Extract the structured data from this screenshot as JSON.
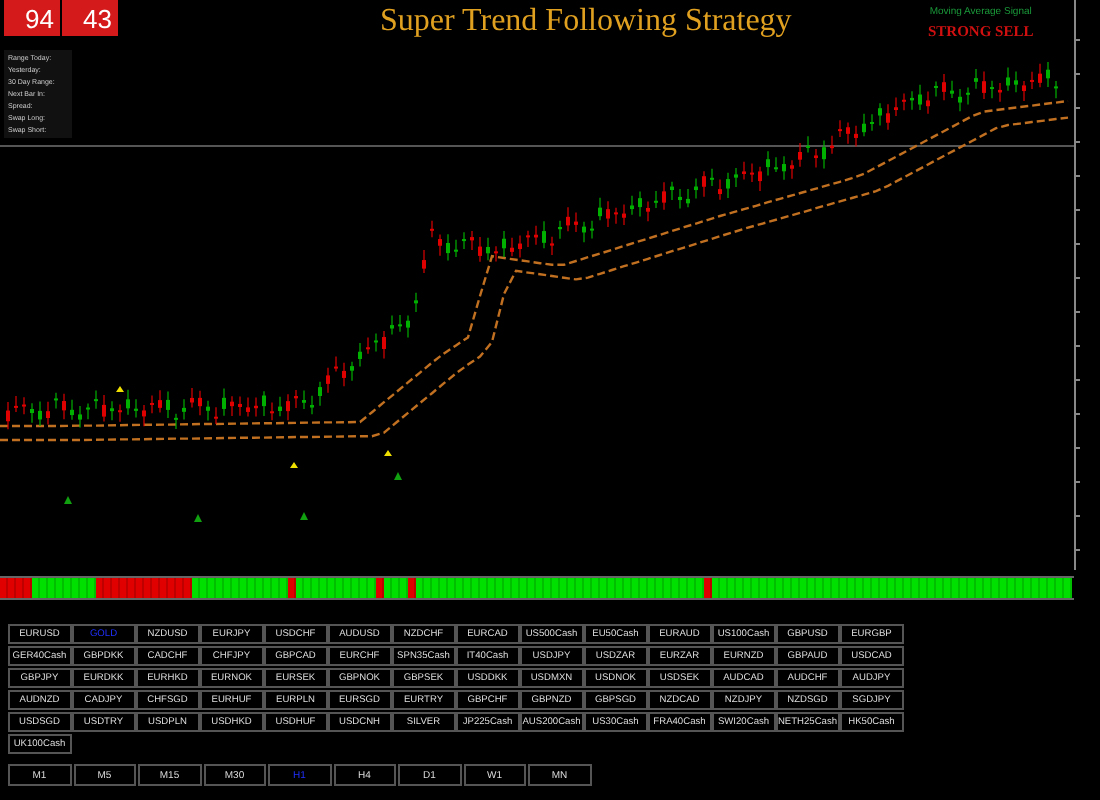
{
  "title": "Super Trend Following Strategy",
  "counters": [
    {
      "value": "94"
    },
    {
      "value": "43"
    }
  ],
  "info_panel": {
    "rows": [
      {
        "label": "Range Today:"
      },
      {
        "label": "Yesterday:"
      },
      {
        "label": "30 Day Range:"
      },
      {
        "label": "Next Bar In:"
      },
      {
        "label": "Spread:"
      },
      {
        "label": "Swap Long:"
      },
      {
        "label": "Swap Short:"
      }
    ]
  },
  "signal": {
    "caption": "Moving Average Signal",
    "verdict": "STRONG SELL"
  },
  "trend_bar": {
    "bars": [
      {
        "kind": "sell"
      },
      {
        "kind": "sell"
      },
      {
        "kind": "sell"
      },
      {
        "kind": "sell"
      },
      {
        "kind": "buy"
      },
      {
        "kind": "buy"
      },
      {
        "kind": "buy"
      },
      {
        "kind": "buy"
      },
      {
        "kind": "buy"
      },
      {
        "kind": "buy"
      },
      {
        "kind": "buy"
      },
      {
        "kind": "buy"
      },
      {
        "kind": "sell"
      },
      {
        "kind": "sell"
      },
      {
        "kind": "sell"
      },
      {
        "kind": "sell"
      },
      {
        "kind": "sell"
      },
      {
        "kind": "sell"
      },
      {
        "kind": "sell"
      },
      {
        "kind": "sell"
      },
      {
        "kind": "sell"
      },
      {
        "kind": "sell"
      },
      {
        "kind": "sell"
      },
      {
        "kind": "sell"
      },
      {
        "kind": "buy"
      },
      {
        "kind": "buy"
      },
      {
        "kind": "buy"
      },
      {
        "kind": "buy"
      },
      {
        "kind": "buy"
      },
      {
        "kind": "buy"
      },
      {
        "kind": "buy"
      },
      {
        "kind": "buy"
      },
      {
        "kind": "buy"
      },
      {
        "kind": "buy"
      },
      {
        "kind": "buy"
      },
      {
        "kind": "buy"
      },
      {
        "kind": "sell"
      },
      {
        "kind": "buy"
      },
      {
        "kind": "buy"
      },
      {
        "kind": "buy"
      },
      {
        "kind": "buy"
      },
      {
        "kind": "buy"
      },
      {
        "kind": "buy"
      },
      {
        "kind": "buy"
      },
      {
        "kind": "buy"
      },
      {
        "kind": "buy"
      },
      {
        "kind": "buy"
      },
      {
        "kind": "sell"
      },
      {
        "kind": "buy"
      },
      {
        "kind": "buy"
      },
      {
        "kind": "buy"
      },
      {
        "kind": "sell"
      },
      {
        "kind": "buy"
      },
      {
        "kind": "buy"
      },
      {
        "kind": "buy"
      },
      {
        "kind": "buy"
      },
      {
        "kind": "buy"
      },
      {
        "kind": "buy"
      },
      {
        "kind": "buy"
      },
      {
        "kind": "buy"
      },
      {
        "kind": "buy"
      },
      {
        "kind": "buy"
      },
      {
        "kind": "buy"
      },
      {
        "kind": "buy"
      },
      {
        "kind": "buy"
      },
      {
        "kind": "buy"
      },
      {
        "kind": "buy"
      },
      {
        "kind": "buy"
      },
      {
        "kind": "buy"
      },
      {
        "kind": "buy"
      },
      {
        "kind": "buy"
      },
      {
        "kind": "buy"
      },
      {
        "kind": "buy"
      },
      {
        "kind": "buy"
      },
      {
        "kind": "buy"
      },
      {
        "kind": "buy"
      },
      {
        "kind": "buy"
      },
      {
        "kind": "buy"
      },
      {
        "kind": "buy"
      },
      {
        "kind": "buy"
      },
      {
        "kind": "buy"
      },
      {
        "kind": "buy"
      },
      {
        "kind": "buy"
      },
      {
        "kind": "buy"
      },
      {
        "kind": "buy"
      },
      {
        "kind": "buy"
      },
      {
        "kind": "buy"
      },
      {
        "kind": "buy"
      },
      {
        "kind": "sell"
      },
      {
        "kind": "buy"
      },
      {
        "kind": "buy"
      },
      {
        "kind": "buy"
      },
      {
        "kind": "buy"
      },
      {
        "kind": "buy"
      },
      {
        "kind": "buy"
      },
      {
        "kind": "buy"
      },
      {
        "kind": "buy"
      },
      {
        "kind": "buy"
      },
      {
        "kind": "buy"
      },
      {
        "kind": "buy"
      },
      {
        "kind": "buy"
      },
      {
        "kind": "buy"
      },
      {
        "kind": "buy"
      },
      {
        "kind": "buy"
      },
      {
        "kind": "buy"
      },
      {
        "kind": "buy"
      },
      {
        "kind": "buy"
      },
      {
        "kind": "buy"
      },
      {
        "kind": "buy"
      },
      {
        "kind": "buy"
      },
      {
        "kind": "buy"
      },
      {
        "kind": "buy"
      },
      {
        "kind": "buy"
      },
      {
        "kind": "buy"
      },
      {
        "kind": "buy"
      },
      {
        "kind": "buy"
      },
      {
        "kind": "buy"
      },
      {
        "kind": "buy"
      },
      {
        "kind": "buy"
      },
      {
        "kind": "buy"
      },
      {
        "kind": "buy"
      },
      {
        "kind": "buy"
      },
      {
        "kind": "buy"
      },
      {
        "kind": "buy"
      },
      {
        "kind": "buy"
      },
      {
        "kind": "buy"
      },
      {
        "kind": "buy"
      },
      {
        "kind": "buy"
      },
      {
        "kind": "buy"
      },
      {
        "kind": "buy"
      },
      {
        "kind": "buy"
      },
      {
        "kind": "buy"
      },
      {
        "kind": "buy"
      },
      {
        "kind": "buy"
      }
    ]
  },
  "symbols": [
    {
      "label": "EURUSD",
      "selected": false
    },
    {
      "label": "GOLD",
      "selected": true
    },
    {
      "label": "NZDUSD",
      "selected": false
    },
    {
      "label": "EURJPY",
      "selected": false
    },
    {
      "label": "USDCHF",
      "selected": false
    },
    {
      "label": "AUDUSD",
      "selected": false
    },
    {
      "label": "NZDCHF",
      "selected": false
    },
    {
      "label": "EURCAD",
      "selected": false
    },
    {
      "label": "US500Cash",
      "selected": false
    },
    {
      "label": "EU50Cash",
      "selected": false
    },
    {
      "label": "EURAUD",
      "selected": false
    },
    {
      "label": "US100Cash",
      "selected": false
    },
    {
      "label": "GBPUSD",
      "selected": false
    },
    {
      "label": "EURGBP",
      "selected": false
    },
    {
      "label": "GER40Cash",
      "selected": false
    },
    {
      "label": "GBPDKK",
      "selected": false
    },
    {
      "label": "CADCHF",
      "selected": false
    },
    {
      "label": "CHFJPY",
      "selected": false
    },
    {
      "label": "GBPCAD",
      "selected": false
    },
    {
      "label": "EURCHF",
      "selected": false
    },
    {
      "label": "SPN35Cash",
      "selected": false
    },
    {
      "label": "IT40Cash",
      "selected": false
    },
    {
      "label": "USDJPY",
      "selected": false
    },
    {
      "label": "USDZAR",
      "selected": false
    },
    {
      "label": "EURZAR",
      "selected": false
    },
    {
      "label": "EURNZD",
      "selected": false
    },
    {
      "label": "GBPAUD",
      "selected": false
    },
    {
      "label": "USDCAD",
      "selected": false
    },
    {
      "label": "GBPJPY",
      "selected": false
    },
    {
      "label": "EURDKK",
      "selected": false
    },
    {
      "label": "EURHKD",
      "selected": false
    },
    {
      "label": "EURNOK",
      "selected": false
    },
    {
      "label": "EURSEK",
      "selected": false
    },
    {
      "label": "GBPNOK",
      "selected": false
    },
    {
      "label": "GBPSEK",
      "selected": false
    },
    {
      "label": "USDDKK",
      "selected": false
    },
    {
      "label": "USDMXN",
      "selected": false
    },
    {
      "label": "USDNOK",
      "selected": false
    },
    {
      "label": "USDSEK",
      "selected": false
    },
    {
      "label": "AUDCAD",
      "selected": false
    },
    {
      "label": "AUDCHF",
      "selected": false
    },
    {
      "label": "AUDJPY",
      "selected": false
    },
    {
      "label": "AUDNZD",
      "selected": false
    },
    {
      "label": "CADJPY",
      "selected": false
    },
    {
      "label": "CHFSGD",
      "selected": false
    },
    {
      "label": "EURHUF",
      "selected": false
    },
    {
      "label": "EURPLN",
      "selected": false
    },
    {
      "label": "EURSGD",
      "selected": false
    },
    {
      "label": "EURTRY",
      "selected": false
    },
    {
      "label": "GBPCHF",
      "selected": false
    },
    {
      "label": "GBPNZD",
      "selected": false
    },
    {
      "label": "GBPSGD",
      "selected": false
    },
    {
      "label": "NZDCAD",
      "selected": false
    },
    {
      "label": "NZDJPY",
      "selected": false
    },
    {
      "label": "NZDSGD",
      "selected": false
    },
    {
      "label": "SGDJPY",
      "selected": false
    },
    {
      "label": "USDSGD",
      "selected": false
    },
    {
      "label": "USDTRY",
      "selected": false
    },
    {
      "label": "USDPLN",
      "selected": false
    },
    {
      "label": "USDHKD",
      "selected": false
    },
    {
      "label": "USDHUF",
      "selected": false
    },
    {
      "label": "USDCNH",
      "selected": false
    },
    {
      "label": "SILVER",
      "selected": false
    },
    {
      "label": "JP225Cash",
      "selected": false
    },
    {
      "label": "AUS200Cash",
      "selected": false
    },
    {
      "label": "US30Cash",
      "selected": false
    },
    {
      "label": "FRA40Cash",
      "selected": false
    },
    {
      "label": "SWI20Cash",
      "selected": false
    },
    {
      "label": "NETH25Cash",
      "selected": false
    },
    {
      "label": "HK50Cash",
      "selected": false
    },
    {
      "label": "UK100Cash",
      "selected": false
    }
  ],
  "timeframes": [
    {
      "label": "M1",
      "selected": false
    },
    {
      "label": "M5",
      "selected": false
    },
    {
      "label": "M15",
      "selected": false
    },
    {
      "label": "M30",
      "selected": false
    },
    {
      "label": "H1",
      "selected": true
    },
    {
      "label": "H4",
      "selected": false
    },
    {
      "label": "D1",
      "selected": false
    },
    {
      "label": "W1",
      "selected": false
    },
    {
      "label": "MN",
      "selected": false
    }
  ]
}
